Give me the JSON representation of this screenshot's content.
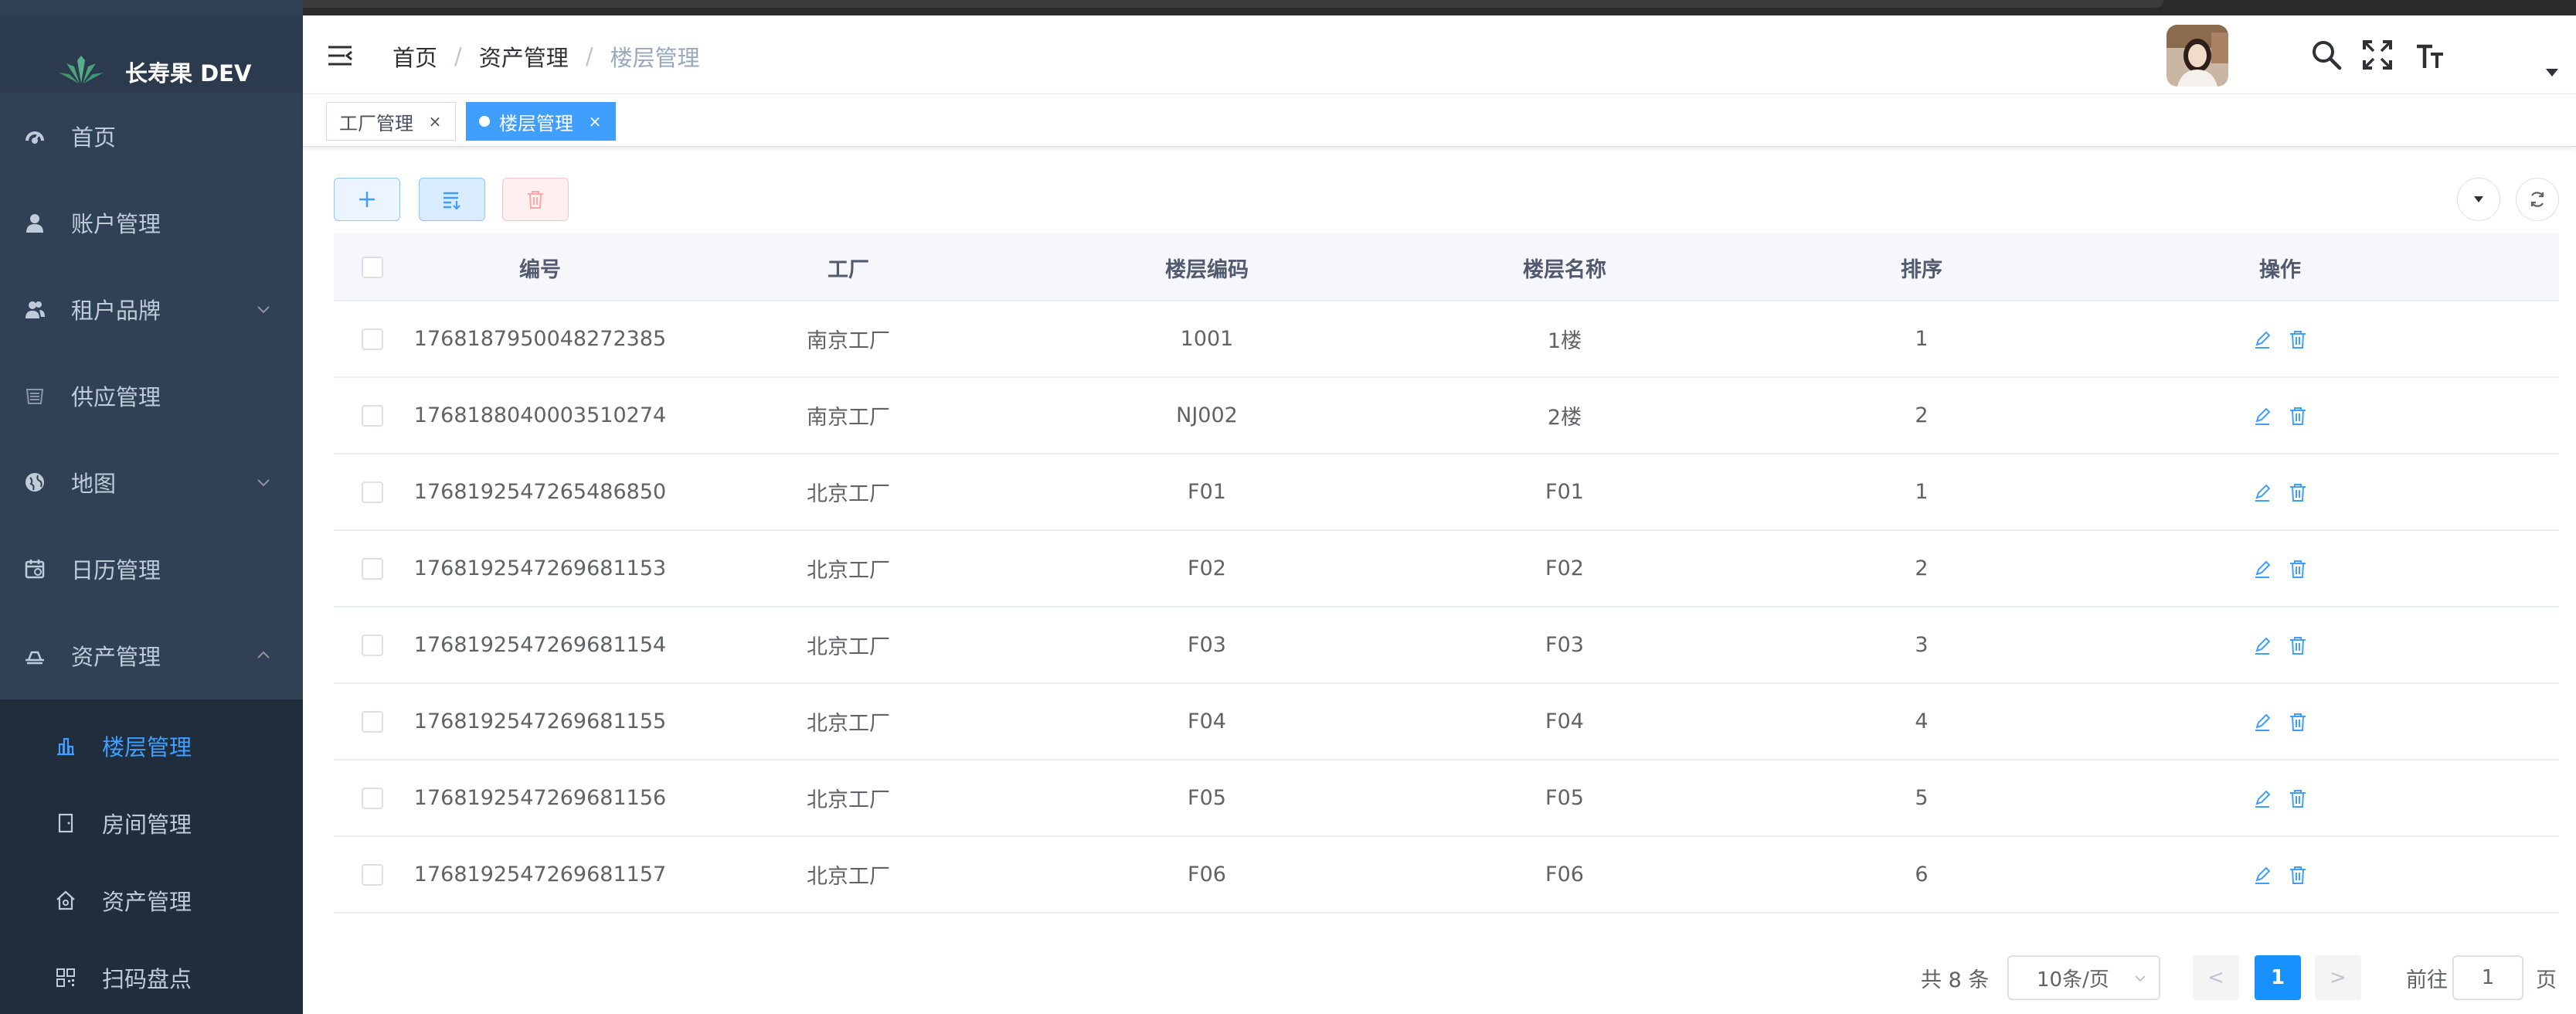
{
  "app": {
    "title": "长寿果 DEV"
  },
  "sidebar": {
    "items": [
      {
        "label": "首页",
        "icon": "dashboard-icon"
      },
      {
        "label": "账户管理",
        "icon": "user-icon"
      },
      {
        "label": "租户品牌",
        "icon": "peoples-icon",
        "expandable": true
      },
      {
        "label": "供应管理",
        "icon": "supply-icon"
      },
      {
        "label": "地图",
        "icon": "globe-icon",
        "expandable": true
      },
      {
        "label": "日历管理",
        "icon": "calendar-icon"
      },
      {
        "label": "资产管理",
        "icon": "asset-icon",
        "expanded": true
      }
    ],
    "sub_items": [
      {
        "label": "楼层管理",
        "icon": "building-icon",
        "active": true
      },
      {
        "label": "房间管理",
        "icon": "door-icon"
      },
      {
        "label": "资产管理",
        "icon": "house-icon"
      },
      {
        "label": "扫码盘点",
        "icon": "qrcode-icon"
      }
    ]
  },
  "header": {
    "breadcrumb": [
      "首页",
      "资产管理",
      "楼层管理"
    ],
    "icons": [
      "search-icon",
      "fullscreen-icon",
      "font-size-icon"
    ]
  },
  "tags": [
    {
      "label": "工厂管理",
      "active": false
    },
    {
      "label": "楼层管理",
      "active": true
    }
  ],
  "tags_close": "×",
  "toolbar": {
    "add": "add-icon",
    "fold": "sort-icon",
    "delete": "delete-icon"
  },
  "table": {
    "columns": [
      "编号",
      "工厂",
      "楼层编码",
      "楼层名称",
      "排序",
      "操作"
    ],
    "rows": [
      {
        "id": "1768187950048272385",
        "factory": "南京工厂",
        "code": "1001",
        "name": "1楼",
        "sort": "1"
      },
      {
        "id": "1768188040003510274",
        "factory": "南京工厂",
        "code": "NJ002",
        "name": "2楼",
        "sort": "2"
      },
      {
        "id": "1768192547265486850",
        "factory": "北京工厂",
        "code": "F01",
        "name": "F01",
        "sort": "1"
      },
      {
        "id": "1768192547269681153",
        "factory": "北京工厂",
        "code": "F02",
        "name": "F02",
        "sort": "2"
      },
      {
        "id": "1768192547269681154",
        "factory": "北京工厂",
        "code": "F03",
        "name": "F03",
        "sort": "3"
      },
      {
        "id": "1768192547269681155",
        "factory": "北京工厂",
        "code": "F04",
        "name": "F04",
        "sort": "4"
      },
      {
        "id": "1768192547269681156",
        "factory": "北京工厂",
        "code": "F05",
        "name": "F05",
        "sort": "5"
      },
      {
        "id": "1768192547269681157",
        "factory": "北京工厂",
        "code": "F06",
        "name": "F06",
        "sort": "6"
      }
    ]
  },
  "pagination": {
    "total_text": "共 8 条",
    "page_size": "10条/页",
    "current_page": "1",
    "goto_label": "前往",
    "goto_value": "1",
    "page_suffix": "页",
    "prev": "<",
    "next": ">"
  },
  "colors": {
    "sidebar": "#304156",
    "sidebar_sub": "#1f2d3d",
    "accent": "#409eff",
    "pager_active": "#1890ff"
  }
}
